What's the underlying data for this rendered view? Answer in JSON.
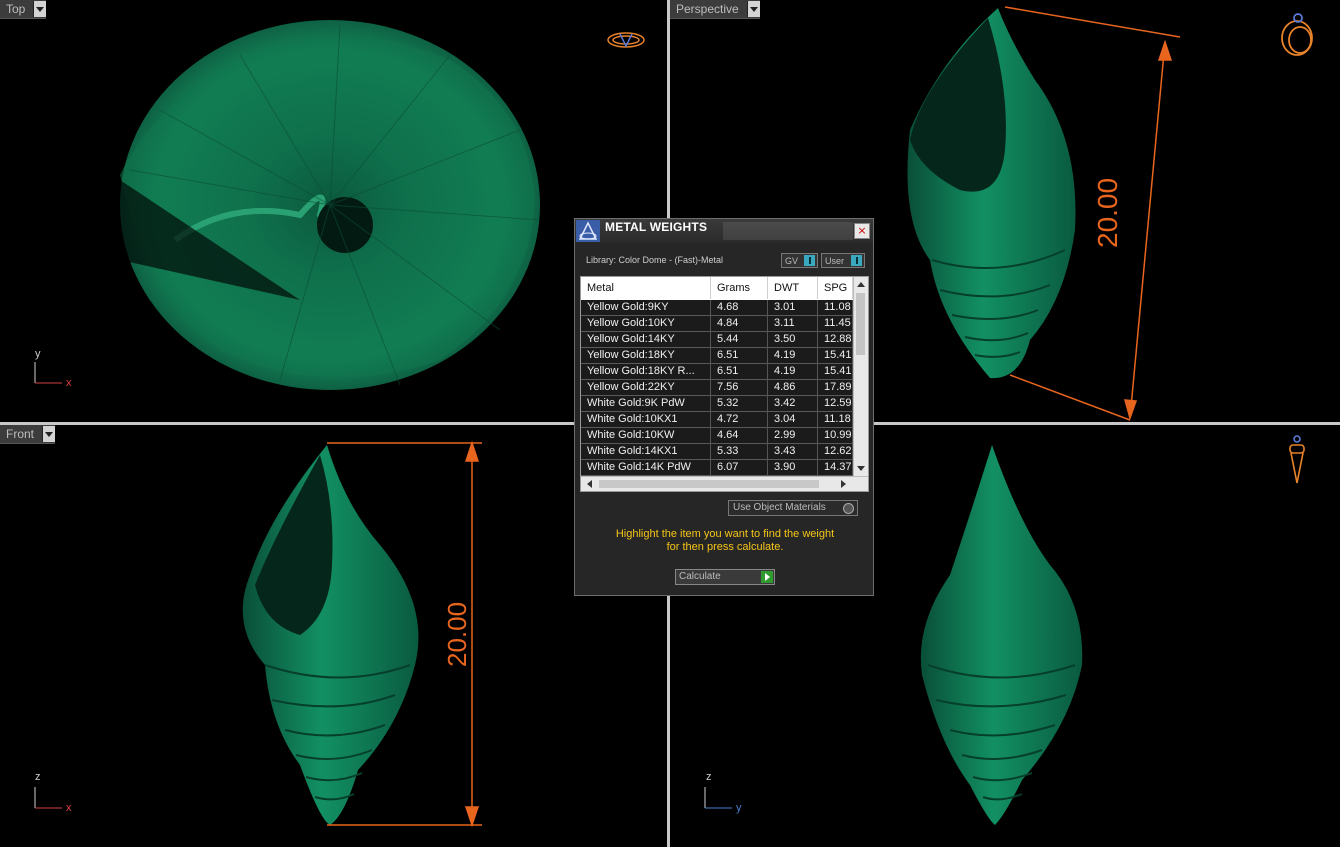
{
  "viewports": {
    "top": {
      "label": "Top",
      "axis_x": "x",
      "axis_y": "y"
    },
    "perspective": {
      "label": "Perspective",
      "dimension": "20.00"
    },
    "front": {
      "label": "Front",
      "axis_x": "x",
      "axis_y": "z",
      "dimension": "20.00"
    },
    "right": {
      "axis_x": "y",
      "axis_y": "z"
    }
  },
  "dialog": {
    "title": "METAL WEIGHTS",
    "close_label": "×",
    "library": "Library: Color Dome - (Fast)-Metal",
    "toggle_gv": "GV",
    "toggle_user": "User",
    "columns": [
      "Metal",
      "Grams",
      "DWT",
      "SPG"
    ],
    "rows": [
      [
        "Yellow Gold:9KY",
        "4.68",
        "3.01",
        "11.08"
      ],
      [
        "Yellow Gold:10KY",
        "4.84",
        "3.11",
        "11.45"
      ],
      [
        "Yellow Gold:14KY",
        "5.44",
        "3.50",
        "12.88"
      ],
      [
        "Yellow Gold:18KY",
        "6.51",
        "4.19",
        "15.41"
      ],
      [
        "Yellow Gold:18KY R...",
        "6.51",
        "4.19",
        "15.41"
      ],
      [
        "Yellow Gold:22KY",
        "7.56",
        "4.86",
        "17.89"
      ],
      [
        "White Gold:9K PdW",
        "5.32",
        "3.42",
        "12.59"
      ],
      [
        "White Gold:10KX1",
        "4.72",
        "3.04",
        "11.18"
      ],
      [
        "White Gold:10KW",
        "4.64",
        "2.99",
        "10.99"
      ],
      [
        "White Gold:14KX1",
        "5.33",
        "3.43",
        "12.62"
      ],
      [
        "White Gold:14K PdW",
        "6.07",
        "3.90",
        "14.37"
      ]
    ],
    "use_object_materials": "Use Object Materials",
    "hint_line1": "Highlight the item you want to find the weight",
    "hint_line2": "for then press calculate.",
    "calculate_label": "Calculate"
  },
  "colors": {
    "shell_green": "#0f6b4c",
    "dimension_orange": "#e8651e",
    "hint_yellow": "#f5c518"
  }
}
